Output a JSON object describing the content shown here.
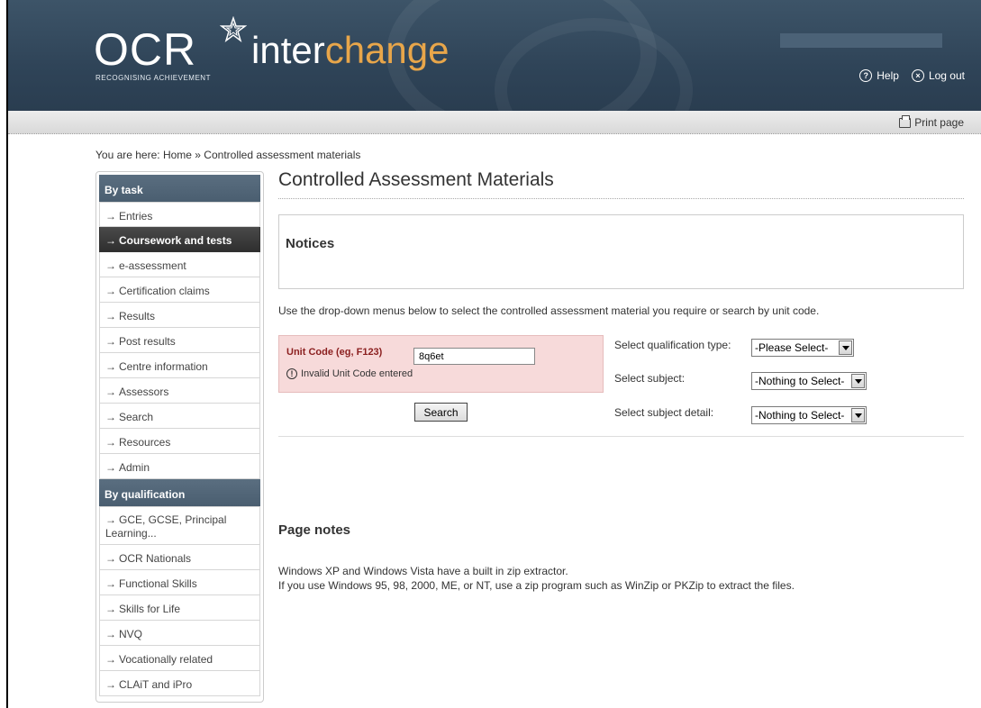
{
  "header": {
    "logo_text": "OCR",
    "logo_tagline": "RECOGNISING ACHIEVEMENT",
    "product_inter": "inter",
    "product_change": "change",
    "help_label": "Help",
    "logout_label": "Log out"
  },
  "subbar": {
    "print_label": "Print page"
  },
  "breadcrumb": "You are here: Home » Controlled assessment materials",
  "sidebar": {
    "by_task_heading": "By task",
    "task_items": [
      "Entries",
      "Coursework and tests",
      "e-assessment",
      "Certification claims",
      "Results",
      "Post results",
      "Centre information",
      "Assessors",
      "Search",
      "Resources",
      "Admin"
    ],
    "by_qualification_heading": "By qualification",
    "qualification_items": [
      "GCE, GCSE, Principal Learning...",
      "OCR Nationals",
      "Functional Skills",
      "Skills for Life",
      "NVQ",
      "Vocationally related",
      "CLAiT and iPro"
    ]
  },
  "main": {
    "title": "Controlled Assessment Materials",
    "notices_heading": "Notices",
    "intro": "Use the drop-down menus below to select the controlled assessment material you require or search by unit code.",
    "unit_code_label": "Unit Code (eg, F123)",
    "unit_code_value": "8q6et",
    "unit_error": "Invalid Unit Code entered",
    "search_button": "Search",
    "qual_type_label": "Select qualification type:",
    "qual_type_value": "-Please Select-",
    "subject_label": "Select subject:",
    "subject_value": "-Nothing to Select-",
    "subject_detail_label": "Select subject detail:",
    "subject_detail_value": "-Nothing to Select-",
    "page_notes_heading": "Page notes",
    "page_notes_line1": "Windows XP and Windows Vista have a built in zip extractor.",
    "page_notes_line2": "If you use Windows 95, 98, 2000, ME, or NT, use a zip program such as WinZip or PKZip to extract the files."
  },
  "colors": {
    "header_bg": "#34495c",
    "accent_orange": "#e8a64a",
    "error_bg": "#f7dada",
    "error_label": "#8b1f1f",
    "active_nav_bg": "#333333"
  }
}
